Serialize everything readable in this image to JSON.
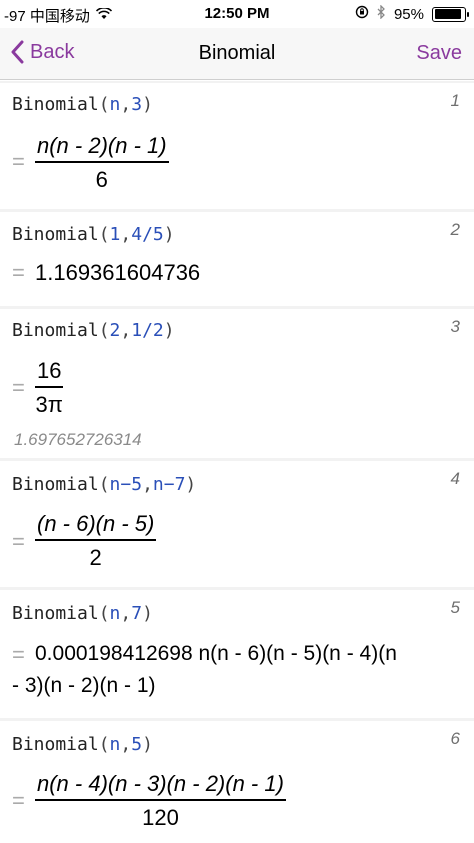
{
  "status_bar": {
    "carrier": "-97 中国移动",
    "time": "12:50 PM",
    "battery_percent": "95%",
    "battery_level": 0.95
  },
  "nav": {
    "back_label": "Back",
    "title": "Binomial",
    "save_label": "Save"
  },
  "entries": [
    {
      "number": "1",
      "func": "Binomial",
      "arg1": "n",
      "arg2": "3",
      "numerator": "n(n - 2)(n - 1)",
      "denominator": "6"
    },
    {
      "number": "2",
      "func": "Binomial",
      "arg1": "1",
      "arg2": "4/5",
      "result": "1.169361604736"
    },
    {
      "number": "3",
      "func": "Binomial",
      "arg1": "2",
      "arg2": "1/2",
      "numerator": "16",
      "denominator": "3π",
      "approx": "1.697652726314"
    },
    {
      "number": "4",
      "func": "Binomial",
      "arg1": "n−5",
      "arg2": "n−7",
      "numerator": "(n - 6)(n - 5)",
      "denominator": "2"
    },
    {
      "number": "5",
      "func": "Binomial",
      "arg1": "n",
      "arg2": "7",
      "result_line1": "0.000198412698 n(n - 6)(n - 5)(n - 4)(n",
      "result_line2": "- 3)(n - 2)(n - 1)"
    },
    {
      "number": "6",
      "func": "Binomial",
      "arg1": "n",
      "arg2": "5",
      "numerator": "n(n - 4)(n - 3)(n - 2)(n - 1)",
      "denominator": "120"
    }
  ]
}
